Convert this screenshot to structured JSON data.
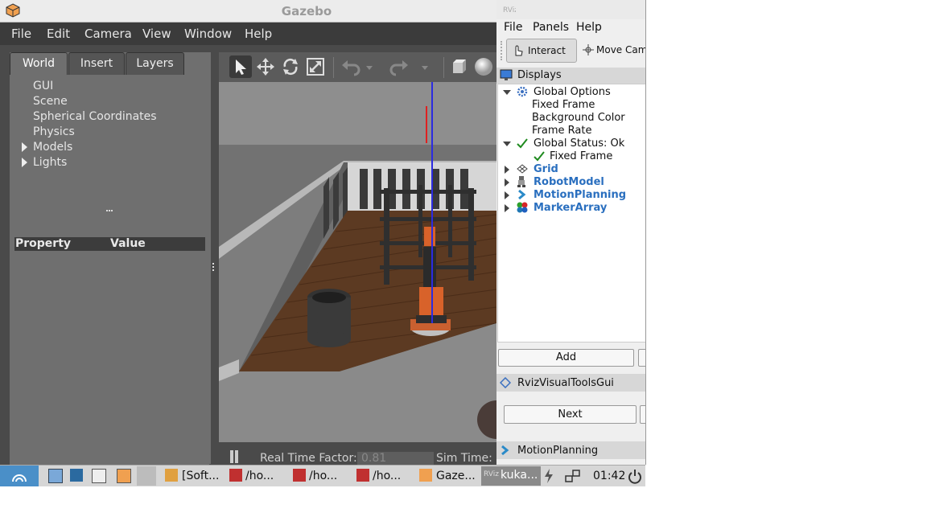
{
  "gazebo": {
    "title": "Gazebo",
    "menu": [
      "File",
      "Edit",
      "Camera",
      "View",
      "Window",
      "Help"
    ],
    "tabs": [
      "World",
      "Insert",
      "Layers"
    ],
    "tree": [
      {
        "label": "GUI",
        "expandable": false
      },
      {
        "label": "Scene",
        "expandable": false
      },
      {
        "label": "Spherical Coordinates",
        "expandable": false
      },
      {
        "label": "Physics",
        "expandable": false
      },
      {
        "label": "Models",
        "expandable": true
      },
      {
        "label": "Lights",
        "expandable": true
      }
    ],
    "property_header": {
      "property": "Property",
      "value": "Value"
    },
    "toolbar": [
      "select-arrow-icon",
      "translate-icon",
      "rotate-icon",
      "scale-icon",
      "undo-icon",
      "undo-dropdown-icon",
      "redo-icon",
      "redo-dropdown-icon",
      "box-icon",
      "sphere-icon"
    ],
    "status": {
      "real_time_factor_label": "Real Time Factor:",
      "real_time_factor_value": "0.81",
      "sim_time_label": "Sim Time:"
    }
  },
  "rviz": {
    "title_icon": "rviz-logo-icon",
    "menu": [
      "File",
      "Panels",
      "Help"
    ],
    "toolbar": {
      "interact": "Interact",
      "move_camera": "Move Cam"
    },
    "displays_title": "Displays",
    "tree": {
      "global_options": "Global Options",
      "fixed_frame": "Fixed Frame",
      "background_color": "Background Color",
      "frame_rate": "Frame Rate",
      "global_status": "Global Status: Ok",
      "status_fixed_frame": "Fixed Frame",
      "grid": "Grid",
      "robot_model": "RobotModel",
      "motion_planning": "MotionPlanning",
      "marker_array": "MarkerArray"
    },
    "add_button": "Add",
    "visual_tools_panel": "RvizVisualToolsGui",
    "next_button": "Next",
    "motion_planning_panel": "MotionPlanning"
  },
  "taskbar": {
    "items": [
      "[Soft...",
      "/ho...",
      "/ho...",
      "/ho...",
      "Gaze...",
      "kuka..."
    ],
    "clock": "01:42"
  }
}
